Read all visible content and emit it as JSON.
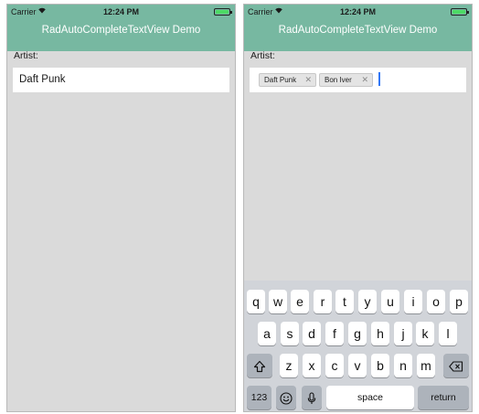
{
  "status": {
    "carrier": "Carrier",
    "time": "12:24 PM"
  },
  "nav": {
    "title": "RadAutoCompleteTextView Demo"
  },
  "form": {
    "label": "Artist:",
    "value": "Daft Punk"
  },
  "tokens": [
    {
      "label": "Daft Punk"
    },
    {
      "label": "Bon Iver"
    }
  ],
  "keyboard": {
    "row1": [
      "q",
      "w",
      "e",
      "r",
      "t",
      "y",
      "u",
      "i",
      "o",
      "p"
    ],
    "row2": [
      "a",
      "s",
      "d",
      "f",
      "g",
      "h",
      "j",
      "k",
      "l"
    ],
    "row3": [
      "z",
      "x",
      "c",
      "v",
      "b",
      "n",
      "m"
    ],
    "numbers_label": "123",
    "space_label": "space",
    "return_label": "return"
  },
  "colors": {
    "nav_bar": "#77b8a1",
    "background": "#dadada",
    "caret": "#3478f6",
    "battery": "#4cd964"
  }
}
